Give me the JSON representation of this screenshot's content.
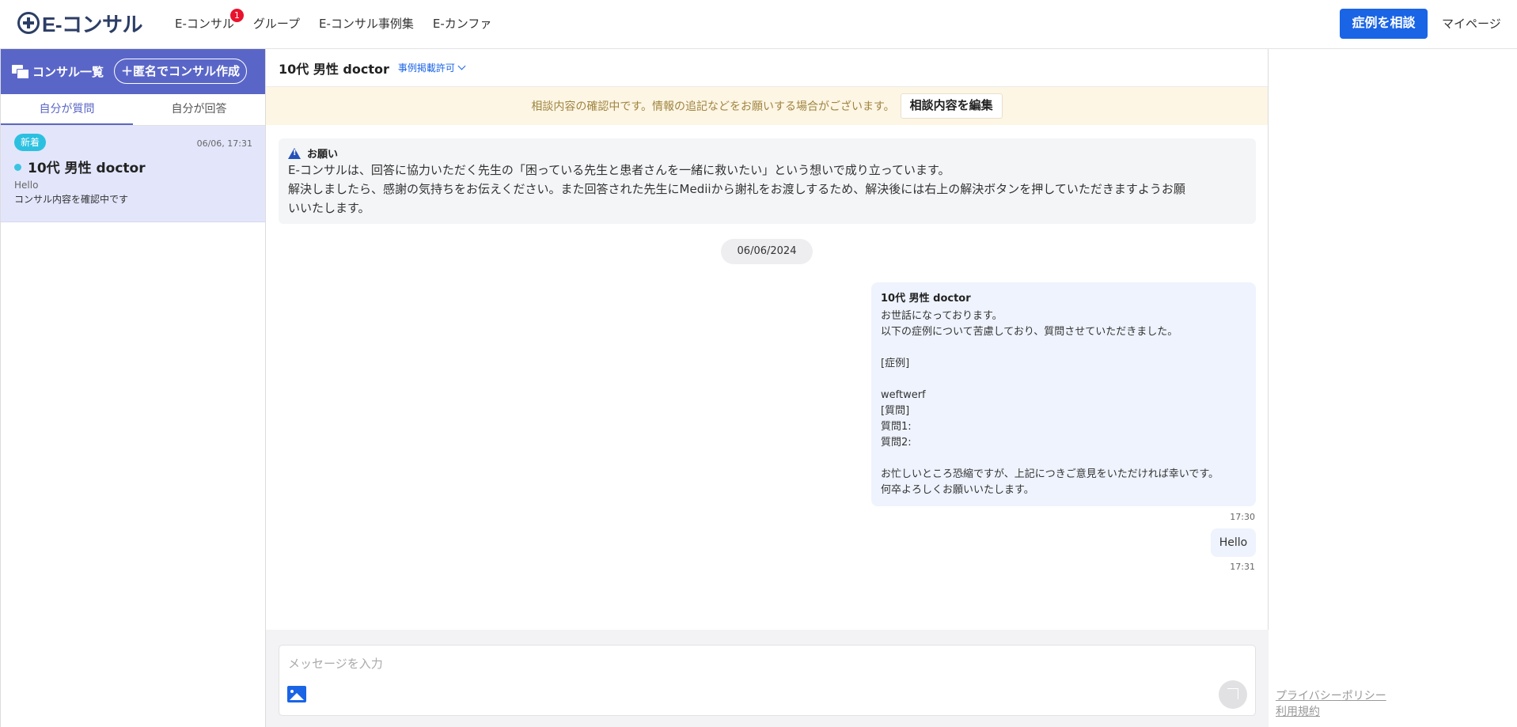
{
  "header": {
    "logo_text": "E-コンサル",
    "nav": [
      {
        "label": "E-コンサル",
        "badge": "1"
      },
      {
        "label": "グループ"
      },
      {
        "label": "E-コンサル事例集"
      },
      {
        "label": "E-カンファ"
      }
    ],
    "consult_button": "症例を相談",
    "mypage": "マイページ",
    "colors": {
      "primary": "#1a64e6",
      "badge": "#e8132d"
    }
  },
  "sidebar": {
    "title": "コンサル一覧",
    "anon_button": "＋匿名でコンサル作成",
    "tabs": [
      "自分が質問",
      "自分が回答"
    ],
    "active_tab": 0,
    "threads": [
      {
        "badge": "新着",
        "time": "06/06, 17:31",
        "title": "10代 男性 doctor",
        "last_message": "Hello",
        "status": "コンサル内容を確認中です"
      }
    ],
    "colors": {
      "header": "#5a66c7",
      "selected": "#e3e6fb"
    }
  },
  "chat": {
    "title": "10代 男性 doctor",
    "permission": "事例掲載許可",
    "notice": "相談内容の確認中です。情報の追記などをお願いする場合がございます。",
    "edit_button": "相談内容を編集",
    "warning": {
      "title": "お願い",
      "lines": [
        "E-コンサルは、回答に協力いただく先生の「困っている先生と患者さんを一緒に救いたい」という想いで成り立っています。",
        "解決しましたら、感謝の気持ちをお伝えください。また回答された先生にMediiから謝礼をお渡しするため、解決後には右上の解決ボタンを押していただきますようお願",
        "いいたします。"
      ]
    },
    "date": "06/06/2024",
    "messages": [
      {
        "sender": "10代 男性 doctor",
        "lines": [
          "お世話になっております。",
          "以下の症例について苦慮しており、質問させていただきました。",
          "",
          "[症例]",
          "",
          "weftwerf",
          "[質問]",
          "質問1:",
          "質問2:",
          "",
          "お忙しいところ恐縮ですが、上記につきご意見をいただければ幸いです。",
          "何卒よろしくお願いいたします。"
        ],
        "time": "17:30"
      },
      {
        "text": "Hello",
        "time": "17:31"
      }
    ],
    "input_placeholder": "メッセージを入力"
  },
  "footer": {
    "privacy": "プライバシーポリシー",
    "terms": "利用規約"
  }
}
